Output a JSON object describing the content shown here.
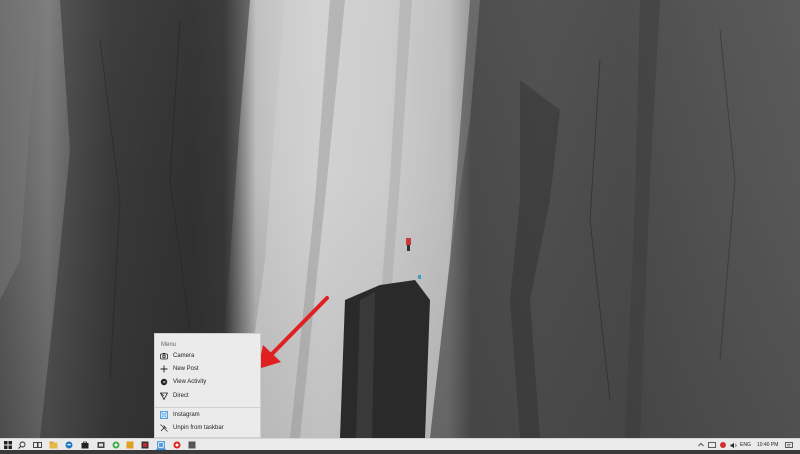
{
  "jumplist": {
    "header": "Menu",
    "tasks": [
      {
        "label": "Camera",
        "icon": "camera-icon"
      },
      {
        "label": "New Post",
        "icon": "plus-icon"
      },
      {
        "label": "View Activity",
        "icon": "activity-icon"
      },
      {
        "label": "Direct",
        "icon": "direct-send-icon"
      }
    ],
    "app": {
      "label": "Instagram",
      "icon": "instagram-icon"
    },
    "unpin": {
      "label": "Unpin from taskbar",
      "icon": "unpin-icon"
    }
  },
  "taskbar": {
    "pinned": [
      "windows-start-icon",
      "search-icon",
      "task-view-icon",
      "file-explorer-icon",
      "edge-icon",
      "store-icon",
      "folder-icon",
      "app-icon",
      "app-icon",
      "app-icon",
      "instagram-icon",
      "app-icon",
      "app-icon"
    ],
    "tray": {
      "language": "ENG",
      "time": "10:40 PM"
    }
  },
  "colors": {
    "arrow": "#e02020",
    "taskbar": "#eaeaea",
    "menu": "#ebebeb"
  }
}
